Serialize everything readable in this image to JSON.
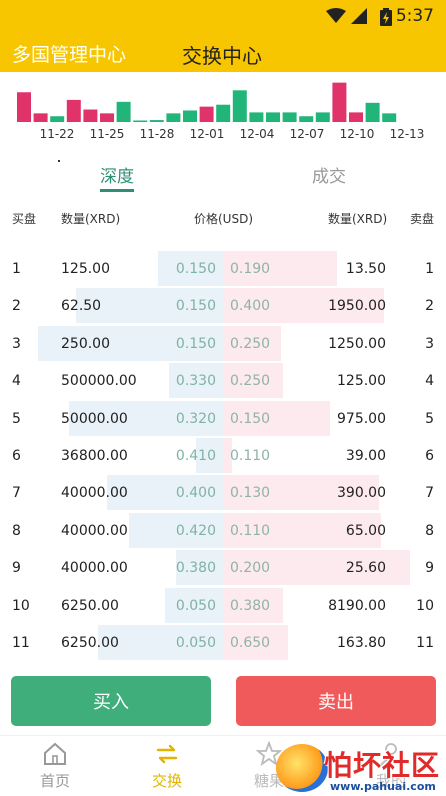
{
  "status": {
    "time": "5:37"
  },
  "header": {
    "left_title": "多国管理中心",
    "title": "交换中心"
  },
  "chart_data": {
    "type": "bar",
    "categories": [
      "11-22",
      "11-25",
      "11-28",
      "12-01",
      "12-04",
      "12-07",
      "12-10",
      "12-13"
    ],
    "bars": [
      {
        "value": 0.62,
        "color": "#e0336a"
      },
      {
        "value": 0.18,
        "color": "#e0336a"
      },
      {
        "value": 0.12,
        "color": "#22b57a"
      },
      {
        "value": 0.46,
        "color": "#e0336a"
      },
      {
        "value": 0.26,
        "color": "#e0336a"
      },
      {
        "value": 0.18,
        "color": "#e0336a"
      },
      {
        "value": 0.42,
        "color": "#22b57a"
      },
      {
        "value": 0.02,
        "color": "#22b57a"
      },
      {
        "value": 0.04,
        "color": "#22b57a"
      },
      {
        "value": 0.18,
        "color": "#22b57a"
      },
      {
        "value": 0.24,
        "color": "#22b57a"
      },
      {
        "value": 0.32,
        "color": "#e0336a"
      },
      {
        "value": 0.36,
        "color": "#22b57a"
      },
      {
        "value": 0.66,
        "color": "#22b57a"
      },
      {
        "value": 0.2,
        "color": "#22b57a"
      },
      {
        "value": 0.2,
        "color": "#22b57a"
      },
      {
        "value": 0.2,
        "color": "#22b57a"
      },
      {
        "value": 0.12,
        "color": "#22b57a"
      },
      {
        "value": 0.2,
        "color": "#22b57a"
      },
      {
        "value": 0.82,
        "color": "#e0336a"
      },
      {
        "value": 0.2,
        "color": "#e0336a"
      },
      {
        "value": 0.4,
        "color": "#22b57a"
      },
      {
        "value": 0.18,
        "color": "#22b57a"
      }
    ]
  },
  "tabs": {
    "depth": "深度",
    "trades": "成交"
  },
  "table_header": {
    "buy": "买盘",
    "buy_qty": "数量(XRD)",
    "price": "价格(USD)",
    "sell_qty": "数量(XRD)",
    "sell": "卖盘"
  },
  "orders": [
    {
      "idx": "1",
      "buy_qty": "125.00",
      "buy_price": "0.150",
      "sell_price": "0.190",
      "sell_qty": "13.50",
      "buy_depth": 0.29,
      "sell_depth": 0.51
    },
    {
      "idx": "2",
      "buy_qty": "62.50",
      "buy_price": "0.150",
      "sell_price": "0.400",
      "sell_qty": "1950.00",
      "buy_depth": 0.66,
      "sell_depth": 0.72
    },
    {
      "idx": "3",
      "buy_qty": "250.00",
      "buy_price": "0.150",
      "sell_price": "0.250",
      "sell_qty": "1250.00",
      "buy_depth": 0.83,
      "sell_depth": 0.26
    },
    {
      "idx": "4",
      "buy_qty": "500000.00",
      "buy_price": "0.330",
      "sell_price": "0.250",
      "sell_qty": "125.00",
      "buy_depth": 0.24,
      "sell_depth": 0.27
    },
    {
      "idx": "5",
      "buy_qty": "50000.00",
      "buy_price": "0.320",
      "sell_price": "0.150",
      "sell_qty": "975.00",
      "buy_depth": 0.69,
      "sell_depth": 0.48
    },
    {
      "idx": "6",
      "buy_qty": "36800.00",
      "buy_price": "0.410",
      "sell_price": "0.110",
      "sell_qty": "39.00",
      "buy_depth": 0.12,
      "sell_depth": 0.04
    },
    {
      "idx": "7",
      "buy_qty": "40000.00",
      "buy_price": "0.400",
      "sell_price": "0.130",
      "sell_qty": "390.00",
      "buy_depth": 0.52,
      "sell_depth": 0.7
    },
    {
      "idx": "8",
      "buy_qty": "40000.00",
      "buy_price": "0.420",
      "sell_price": "0.110",
      "sell_qty": "65.00",
      "buy_depth": 0.42,
      "sell_depth": 0.71
    },
    {
      "idx": "9",
      "buy_qty": "40000.00",
      "buy_price": "0.380",
      "sell_price": "0.200",
      "sell_qty": "25.60",
      "buy_depth": 0.21,
      "sell_depth": 0.84
    },
    {
      "idx": "10",
      "buy_qty": "6250.00",
      "buy_price": "0.050",
      "sell_price": "0.380",
      "sell_qty": "8190.00",
      "buy_depth": 0.26,
      "sell_depth": 0.27
    },
    {
      "idx": "11",
      "buy_qty": "6250.00",
      "buy_price": "0.050",
      "sell_price": "0.650",
      "sell_qty": "163.80",
      "buy_depth": 0.56,
      "sell_depth": 0.29
    }
  ],
  "actions": {
    "buy": "买入",
    "sell": "卖出"
  },
  "nav": {
    "home": "首页",
    "trade": "交换",
    "candy": "糖果",
    "me": "我的"
  },
  "watermark": {
    "text": "怕坏社区",
    "url": "www.pahuai.com"
  }
}
